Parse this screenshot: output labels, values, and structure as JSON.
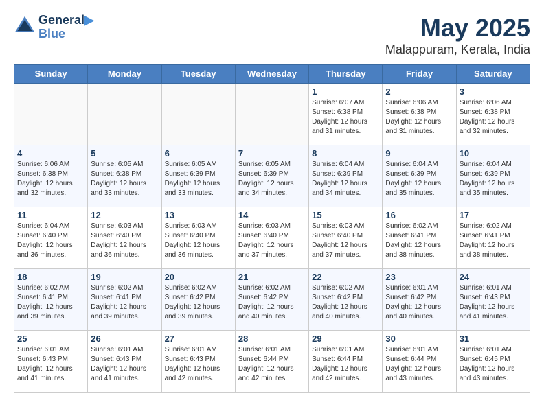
{
  "header": {
    "logo_line1": "General",
    "logo_line2": "Blue",
    "month": "May 2025",
    "location": "Malappuram, Kerala, India"
  },
  "weekdays": [
    "Sunday",
    "Monday",
    "Tuesday",
    "Wednesday",
    "Thursday",
    "Friday",
    "Saturday"
  ],
  "weeks": [
    [
      {
        "day": "",
        "content": ""
      },
      {
        "day": "",
        "content": ""
      },
      {
        "day": "",
        "content": ""
      },
      {
        "day": "",
        "content": ""
      },
      {
        "day": "1",
        "content": "Sunrise: 6:07 AM\nSunset: 6:38 PM\nDaylight: 12 hours\nand 31 minutes."
      },
      {
        "day": "2",
        "content": "Sunrise: 6:06 AM\nSunset: 6:38 PM\nDaylight: 12 hours\nand 31 minutes."
      },
      {
        "day": "3",
        "content": "Sunrise: 6:06 AM\nSunset: 6:38 PM\nDaylight: 12 hours\nand 32 minutes."
      }
    ],
    [
      {
        "day": "4",
        "content": "Sunrise: 6:06 AM\nSunset: 6:38 PM\nDaylight: 12 hours\nand 32 minutes."
      },
      {
        "day": "5",
        "content": "Sunrise: 6:05 AM\nSunset: 6:38 PM\nDaylight: 12 hours\nand 33 minutes."
      },
      {
        "day": "6",
        "content": "Sunrise: 6:05 AM\nSunset: 6:39 PM\nDaylight: 12 hours\nand 33 minutes."
      },
      {
        "day": "7",
        "content": "Sunrise: 6:05 AM\nSunset: 6:39 PM\nDaylight: 12 hours\nand 34 minutes."
      },
      {
        "day": "8",
        "content": "Sunrise: 6:04 AM\nSunset: 6:39 PM\nDaylight: 12 hours\nand 34 minutes."
      },
      {
        "day": "9",
        "content": "Sunrise: 6:04 AM\nSunset: 6:39 PM\nDaylight: 12 hours\nand 35 minutes."
      },
      {
        "day": "10",
        "content": "Sunrise: 6:04 AM\nSunset: 6:39 PM\nDaylight: 12 hours\nand 35 minutes."
      }
    ],
    [
      {
        "day": "11",
        "content": "Sunrise: 6:04 AM\nSunset: 6:40 PM\nDaylight: 12 hours\nand 36 minutes."
      },
      {
        "day": "12",
        "content": "Sunrise: 6:03 AM\nSunset: 6:40 PM\nDaylight: 12 hours\nand 36 minutes."
      },
      {
        "day": "13",
        "content": "Sunrise: 6:03 AM\nSunset: 6:40 PM\nDaylight: 12 hours\nand 36 minutes."
      },
      {
        "day": "14",
        "content": "Sunrise: 6:03 AM\nSunset: 6:40 PM\nDaylight: 12 hours\nand 37 minutes."
      },
      {
        "day": "15",
        "content": "Sunrise: 6:03 AM\nSunset: 6:40 PM\nDaylight: 12 hours\nand 37 minutes."
      },
      {
        "day": "16",
        "content": "Sunrise: 6:02 AM\nSunset: 6:41 PM\nDaylight: 12 hours\nand 38 minutes."
      },
      {
        "day": "17",
        "content": "Sunrise: 6:02 AM\nSunset: 6:41 PM\nDaylight: 12 hours\nand 38 minutes."
      }
    ],
    [
      {
        "day": "18",
        "content": "Sunrise: 6:02 AM\nSunset: 6:41 PM\nDaylight: 12 hours\nand 39 minutes."
      },
      {
        "day": "19",
        "content": "Sunrise: 6:02 AM\nSunset: 6:41 PM\nDaylight: 12 hours\nand 39 minutes."
      },
      {
        "day": "20",
        "content": "Sunrise: 6:02 AM\nSunset: 6:42 PM\nDaylight: 12 hours\nand 39 minutes."
      },
      {
        "day": "21",
        "content": "Sunrise: 6:02 AM\nSunset: 6:42 PM\nDaylight: 12 hours\nand 40 minutes."
      },
      {
        "day": "22",
        "content": "Sunrise: 6:02 AM\nSunset: 6:42 PM\nDaylight: 12 hours\nand 40 minutes."
      },
      {
        "day": "23",
        "content": "Sunrise: 6:01 AM\nSunset: 6:42 PM\nDaylight: 12 hours\nand 40 minutes."
      },
      {
        "day": "24",
        "content": "Sunrise: 6:01 AM\nSunset: 6:43 PM\nDaylight: 12 hours\nand 41 minutes."
      }
    ],
    [
      {
        "day": "25",
        "content": "Sunrise: 6:01 AM\nSunset: 6:43 PM\nDaylight: 12 hours\nand 41 minutes."
      },
      {
        "day": "26",
        "content": "Sunrise: 6:01 AM\nSunset: 6:43 PM\nDaylight: 12 hours\nand 41 minutes."
      },
      {
        "day": "27",
        "content": "Sunrise: 6:01 AM\nSunset: 6:43 PM\nDaylight: 12 hours\nand 42 minutes."
      },
      {
        "day": "28",
        "content": "Sunrise: 6:01 AM\nSunset: 6:44 PM\nDaylight: 12 hours\nand 42 minutes."
      },
      {
        "day": "29",
        "content": "Sunrise: 6:01 AM\nSunset: 6:44 PM\nDaylight: 12 hours\nand 42 minutes."
      },
      {
        "day": "30",
        "content": "Sunrise: 6:01 AM\nSunset: 6:44 PM\nDaylight: 12 hours\nand 43 minutes."
      },
      {
        "day": "31",
        "content": "Sunrise: 6:01 AM\nSunset: 6:45 PM\nDaylight: 12 hours\nand 43 minutes."
      }
    ]
  ]
}
